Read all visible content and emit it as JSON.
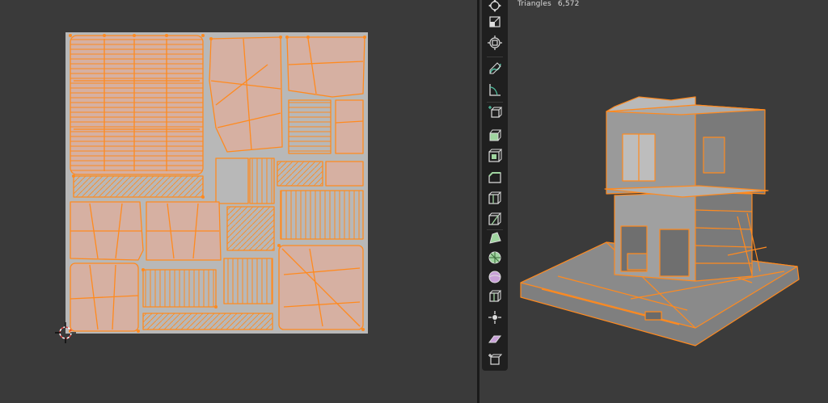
{
  "uv_editor": {
    "canvas_color": "#b8b8b8",
    "island_fill": "#d6b0a2",
    "edge_color": "#ff8a1f"
  },
  "viewport": {
    "stats": {
      "label": "Triangles",
      "value": "6,572"
    },
    "accent_color": "#ff8a1f"
  },
  "toolbar": {
    "tools": [
      {
        "name": "move-tool",
        "icon": "move-icon"
      },
      {
        "name": "scale-tool",
        "icon": "scale-icon"
      },
      {
        "name": "transform-tool",
        "icon": "transform-icon"
      },
      {
        "name": "annotate-tool",
        "icon": "annotate-icon"
      },
      {
        "name": "measure-tool",
        "icon": "measure-icon"
      },
      {
        "name": "add-cube-tool",
        "icon": "add-cube-icon"
      },
      {
        "name": "extrude-tool",
        "icon": "extrude-icon"
      },
      {
        "name": "inset-tool",
        "icon": "inset-icon"
      },
      {
        "name": "bevel-tool",
        "icon": "bevel-icon"
      },
      {
        "name": "loop-cut-tool",
        "icon": "loop-cut-icon"
      },
      {
        "name": "knife-tool",
        "icon": "knife-icon"
      },
      {
        "name": "poly-build-tool",
        "icon": "poly-build-icon"
      },
      {
        "name": "spin-tool",
        "icon": "spin-icon"
      },
      {
        "name": "smooth-tool",
        "icon": "smooth-icon"
      },
      {
        "name": "edge-slide-tool",
        "icon": "edge-slide-icon"
      },
      {
        "name": "shrink-fatten-tool",
        "icon": "shrink-fatten-icon"
      },
      {
        "name": "shear-tool",
        "icon": "shear-icon"
      },
      {
        "name": "rip-region-tool",
        "icon": "rip-region-icon"
      }
    ]
  }
}
